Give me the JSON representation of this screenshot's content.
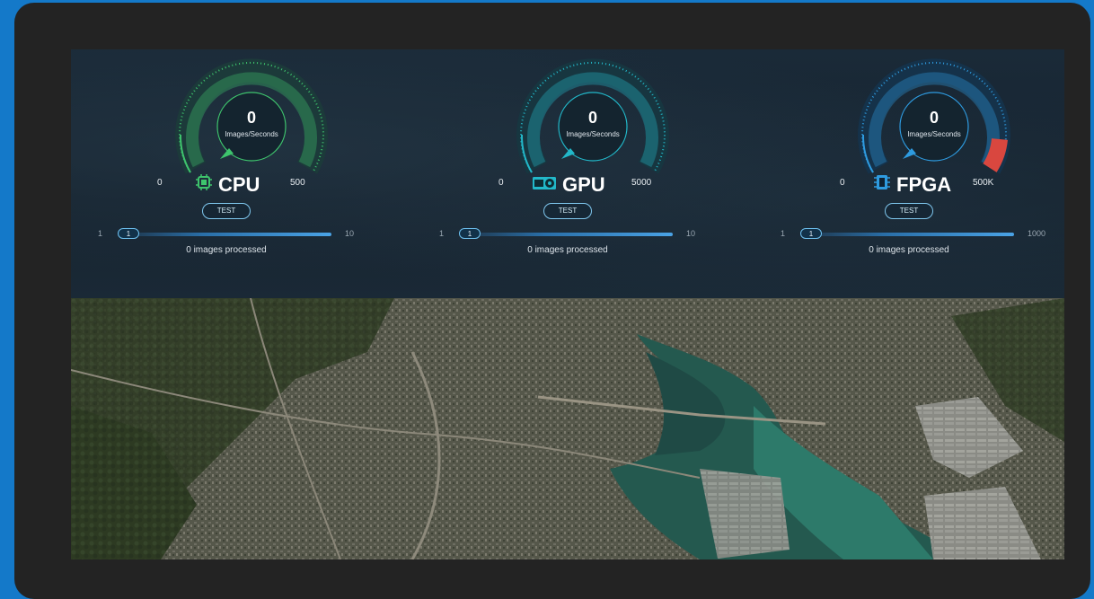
{
  "gauges": [
    {
      "name": "CPU",
      "value": "0",
      "unit": "Images/Seconds",
      "min": "0",
      "max": "500",
      "accent": "#3ec46d",
      "redzone": false,
      "chip_icon": "cpu-chip-icon",
      "chip_label": "",
      "test_label": "TEST",
      "slider_min": "1",
      "slider_max": "10",
      "slider_value": "1",
      "processed": "0 images processed"
    },
    {
      "name": "GPU",
      "value": "0",
      "unit": "Images/Seconds",
      "min": "0",
      "max": "5000",
      "accent": "#22b8c9",
      "redzone": false,
      "chip_icon": "gpu-card-icon",
      "chip_label": "",
      "test_label": "TEST",
      "slider_min": "1",
      "slider_max": "10",
      "slider_value": "1",
      "processed": "0 images processed"
    },
    {
      "name": "FPGA",
      "value": "0",
      "unit": "Images/Seconds",
      "min": "0",
      "max": "500K",
      "accent": "#2e9be0",
      "redzone": true,
      "redzone_color": "#d9473f",
      "chip_icon": "fpga-chip-icon",
      "chip_label": "",
      "test_label": "TEST",
      "slider_min": "1",
      "slider_max": "1000",
      "slider_value": "1",
      "processed": "0 images processed"
    }
  ],
  "background_image": "aerial-satellite-map"
}
